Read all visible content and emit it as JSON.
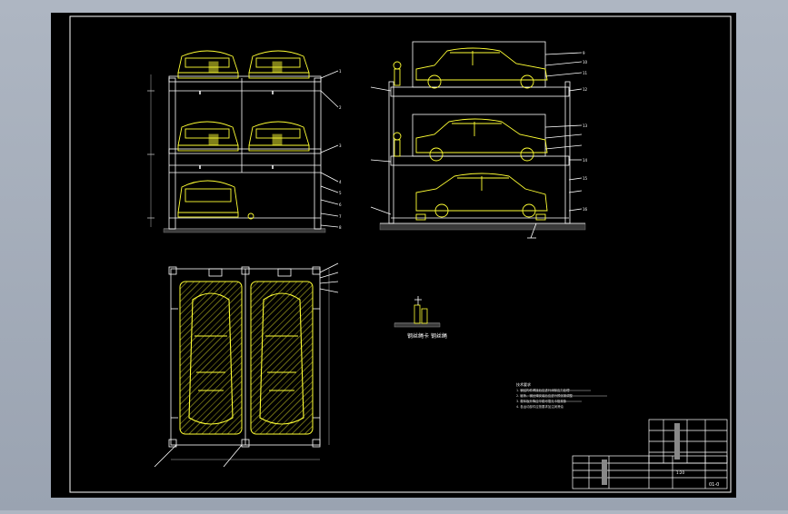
{
  "drawing": {
    "colors": {
      "background": "#000000",
      "frame": "#ffffff",
      "car": "#ffff33",
      "structure": "#ffffff",
      "dimension": "#d8d8d8",
      "outer_bg": "#a3acb9"
    },
    "detail_caption": "钢丝绳卡 钢丝绳",
    "callout_numbers": [
      "1",
      "2",
      "3",
      "4",
      "5",
      "6",
      "7",
      "8",
      "9",
      "10",
      "11",
      "12",
      "13",
      "14",
      "15",
      "16"
    ],
    "notes": [
      "技术要求",
      "1. 钢结构件焊接后应进行消除应力处理",
      "2. 链条、钢丝绳安装后应进行预张紧调整",
      "3. 载车板升降应平稳可靠无卡阻现象",
      "4. 各运动部件应按要求加注润滑油"
    ],
    "title_block": {
      "drawing_no": "01-0",
      "scale": "1:20"
    }
  }
}
